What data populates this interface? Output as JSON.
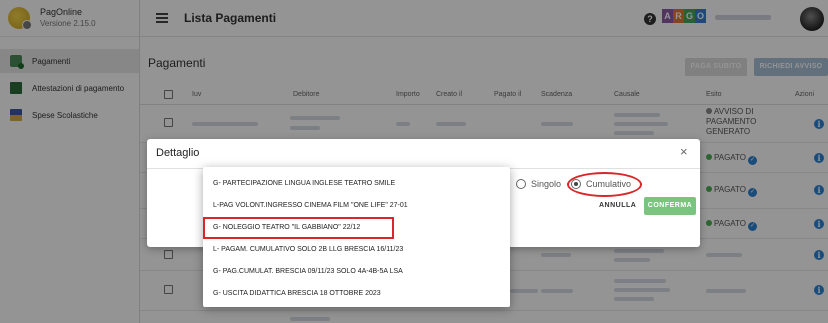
{
  "brand": {
    "name": "PagOnline",
    "version": "Versione 2.15.0"
  },
  "sidebar": {
    "items": [
      {
        "label": "Pagamenti",
        "icon": "payment-icon",
        "active": true
      },
      {
        "label": "Attestazioni di pagamento",
        "icon": "certificate-icon",
        "active": false
      },
      {
        "label": "Spese Scolastiche",
        "icon": "school-icon",
        "active": false
      }
    ]
  },
  "header": {
    "title": "Lista Pagamenti",
    "help": "?",
    "argo_letters": [
      "A",
      "R",
      "G",
      "O"
    ],
    "argo_colors": [
      "#8e5aa6",
      "#e07a34",
      "#4aa55b",
      "#3b7ad0"
    ]
  },
  "main": {
    "title": "Pagamenti",
    "pay_now_label": "PAGA SUBITO",
    "request_notice_label": "RICHIEDI AVVISO",
    "columns": [
      "Iuv",
      "Debitore",
      "Importo",
      "Creato il",
      "Pagato il",
      "Scadenza",
      "Causale",
      "Esito",
      "Azioni"
    ]
  },
  "rows": [
    {
      "esito": "AVVISO DI PAGAMENTO GENERATO",
      "status": "avviso"
    },
    {
      "esito": "PAGATO",
      "status": "pagato"
    },
    {
      "esito": "PAGATO",
      "status": "pagato"
    },
    {
      "esito": "PAGATO",
      "status": "pagato"
    }
  ],
  "info_glyph": "i",
  "check_glyph": "✓",
  "dialog": {
    "title": "Dettaglio",
    "close": "×",
    "radio_single": "Singolo",
    "radio_cumulative": "Cumulativo",
    "cancel_label": "ANNULLA",
    "confirm_label": "CONFERMA"
  },
  "dropdown": {
    "options": [
      "G- PARTECIPAZIONE LINGUA INGLESE TEATRO SMILE",
      "L-PAG VOLONT.INGRESSO CINEMA FILM \"ONE LIFE\" 27-01",
      "G- NOLEGGIO TEATRO \"IL GABBIANO\" 22/12",
      "L- PAGAM. CUMULATIVO SOLO 2B LLG BRESCIA 16/11/23",
      "G- PAG.CUMULAT. BRESCIA 09/11/23 SOLO 4A-4B-5A LSA",
      "G- USCITA DIDATTICA BRESCIA 18 OTTOBRE 2023"
    ],
    "highlighted_index": 2
  }
}
